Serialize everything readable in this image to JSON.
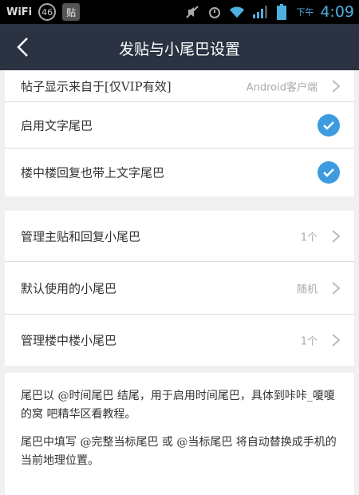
{
  "statusbar": {
    "carrier": "WiFi",
    "badge_circle": "46",
    "badge_box": "贴",
    "ampm": "下午",
    "time": "4:09",
    "icons": [
      "mute-icon",
      "alarm-icon",
      "wifi-icon",
      "signal-3g-icon",
      "battery-icon"
    ]
  },
  "header": {
    "title": "发贴与小尾巴设置"
  },
  "settings": {
    "device_row": {
      "label": "帖子显示来自于[仅VIP有效]",
      "value": "Android客户端"
    },
    "text_tail": {
      "label": "启用文字尾巴",
      "checked": true
    },
    "floor_tail": {
      "label": "楼中楼回复也带上文字尾巴",
      "checked": true
    },
    "manage_main": {
      "label": "管理主贴和回复小尾巴",
      "value": "1个"
    },
    "default_tail": {
      "label": "默认使用的小尾巴",
      "value": "随机"
    },
    "manage_floor": {
      "label": "管理楼中楼小尾巴",
      "value": "1个"
    }
  },
  "description": {
    "p1": "尾巴以 @时间尾巴 结尾，用于启用时间尾巴，具体到咔咔_嗄嗄的窝 吧精华区看教程。",
    "p2": "尾巴中填写 @完整当标尾巴 或 @当标尾巴 将自动替换成手机的当前地理位置。",
    "p3": ""
  },
  "colors": {
    "accent": "#3d9be0",
    "titlebar": "#2b3241",
    "statusbar": "#000000"
  }
}
